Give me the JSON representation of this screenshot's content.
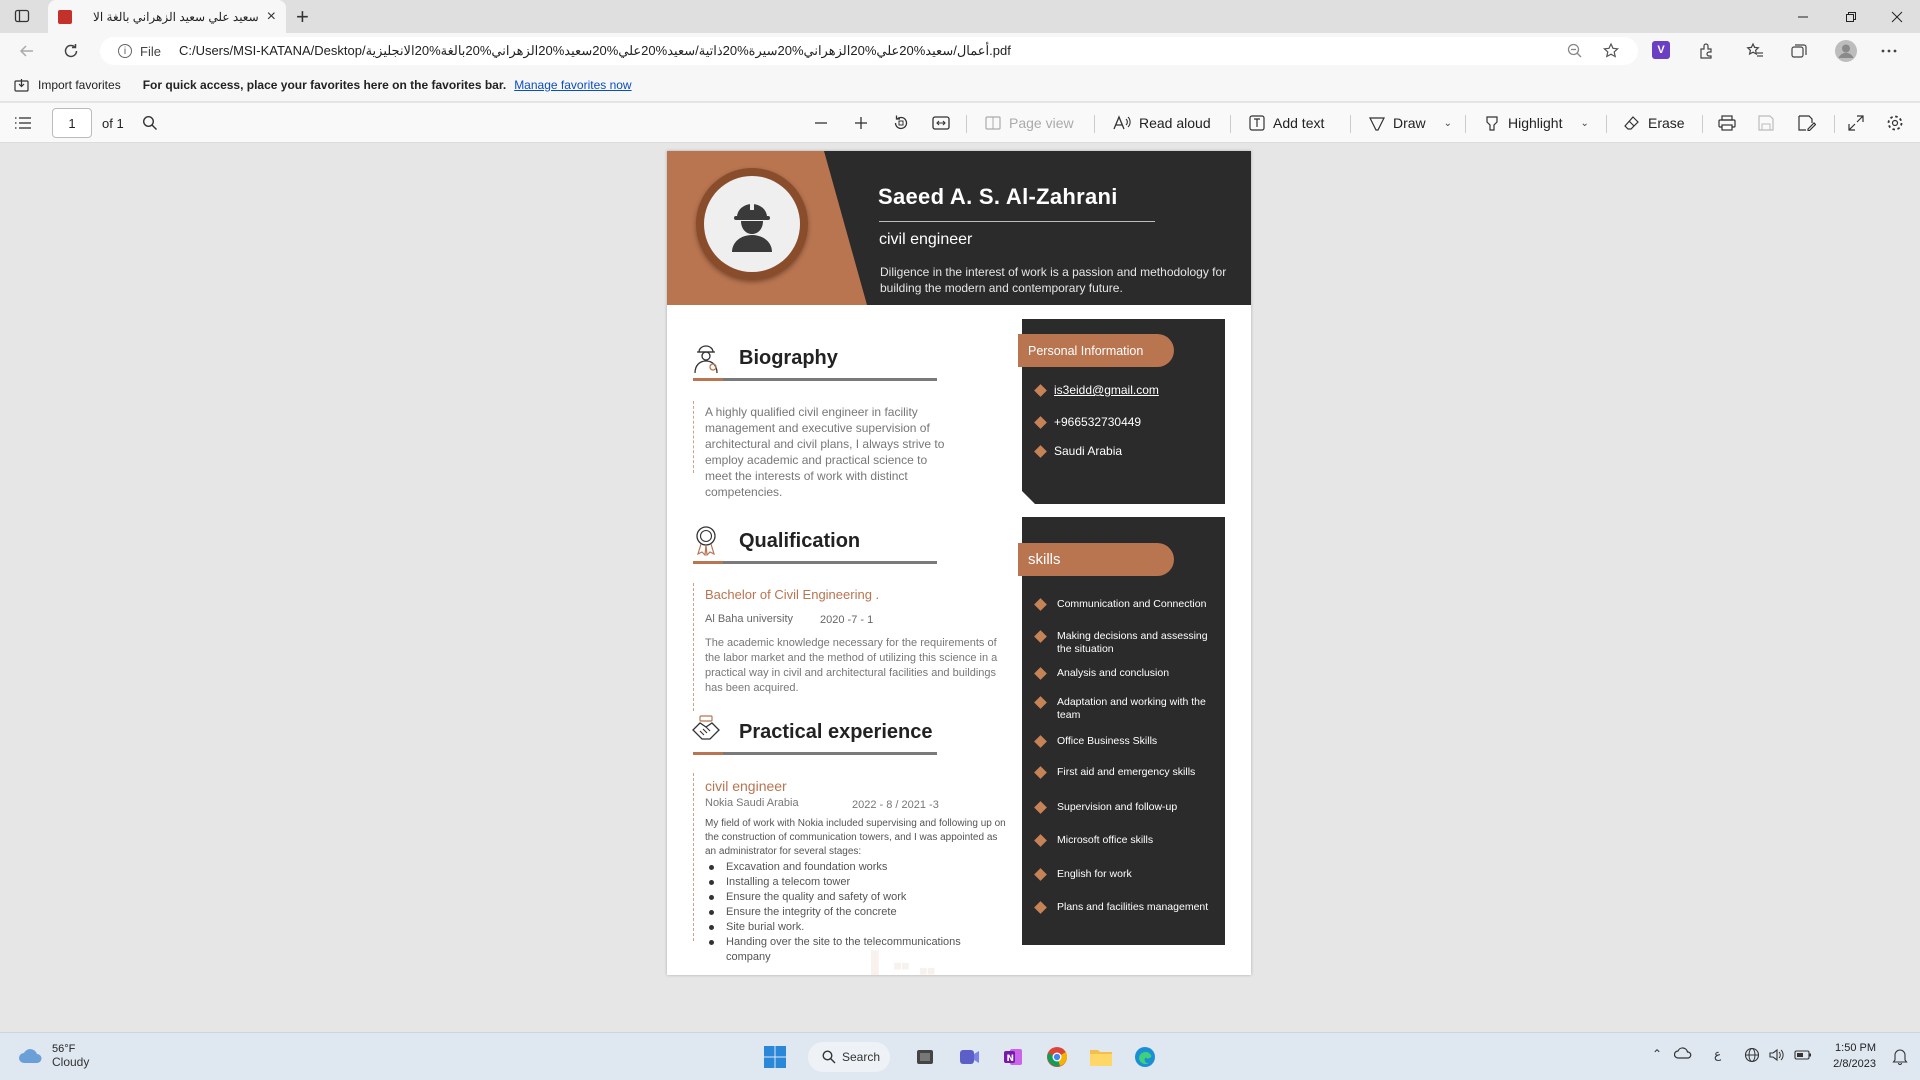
{
  "browser": {
    "tab_title": "سعيد علي سعيد الزهراني بالغة الا",
    "address_scheme": "File",
    "address_path": "C:/Users/MSI-KATANA/Desktop/أعمال/سعيد%20علي%20الزهراني%20سيرة%20ذاتية/سعيد%20علي%20سعيد%20الزهراني%20بالغة%20الانجليزية.pdf",
    "favorites": {
      "import_label": "Import favorites",
      "hint": "For quick access, place your favorites here on the favorites bar.",
      "manage_link": "Manage favorites now"
    }
  },
  "pdf_toolbar": {
    "page_number": "1",
    "page_total": "of 1",
    "page_view": "Page view",
    "read_aloud": "Read aloud",
    "add_text": "Add text",
    "draw": "Draw",
    "highlight": "Highlight",
    "erase": "Erase"
  },
  "resume": {
    "name": "Saeed A. S. Al-Zahrani",
    "job_title": "civil engineer",
    "tagline": "Diligence in the interest of work is a passion and methodology for building the modern and contemporary future.",
    "biography": {
      "heading": "Biography",
      "text": "A highly qualified civil engineer in facility management and executive supervision of architectural and civil plans, I always strive to employ academic and practical science to meet the interests of work with distinct competencies."
    },
    "qualification": {
      "heading": "Qualification",
      "degree": "Bachelor of Civil Engineering .",
      "university": "Al Baha university",
      "date": "2020 -7 - 1",
      "description": "The academic knowledge necessary for the requirements of the labor market and the method of utilizing this science in a practical way in civil and architectural facilities and buildings has been acquired."
    },
    "experience": {
      "heading": "Practical experience",
      "role": "civil engineer",
      "company": "Nokia Saudi Arabia",
      "dates": "2022 - 8  / 2021 -3",
      "description": "My field of work with Nokia included supervising and following up on the construction of communication towers, and I was appointed as an administrator for several stages:",
      "stages": [
        "Excavation and foundation works",
        "Installing a telecom tower",
        "Ensure the quality and safety of work",
        "Ensure the integrity of the concrete",
        "Site burial work.",
        "Handing over the site to the telecommunications company"
      ]
    },
    "personal_info": {
      "heading": "Personal Information",
      "email": "is3eidd@gmail.com",
      "phone": "+966532730449",
      "country": "Saudi Arabia"
    },
    "skills": {
      "heading": "skills",
      "items": [
        "Communication and Connection",
        "Making decisions and assessing the situation",
        "Analysis and conclusion",
        "Adaptation and working with the team",
        "Office Business Skills",
        "First aid and emergency skills",
        "Supervision and follow-up",
        "Microsoft office skills",
        "English for work",
        "Plans and facilities management"
      ]
    },
    "watermark": "مستقل",
    "colors": {
      "accent": "#b97450",
      "dark": "#2b2b2b"
    }
  },
  "taskbar": {
    "weather_temp": "56°F",
    "weather_cond": "Cloudy",
    "search_label": "Search",
    "lang": "ع",
    "time": "1:50 PM",
    "date": "2/8/2023"
  }
}
